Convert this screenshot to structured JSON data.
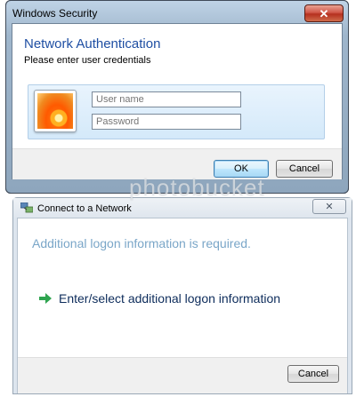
{
  "security_dialog": {
    "title": "Windows Security",
    "heading": "Network Authentication",
    "subheading": "Please enter user credentials",
    "username_placeholder": "User name",
    "password_placeholder": "Password",
    "ok_label": "OK",
    "cancel_label": "Cancel",
    "close_glyph": "✕"
  },
  "watermark": "photobucket",
  "network_dialog": {
    "title": "Connect to a Network",
    "info_text": "Additional logon information is required.",
    "option_text": "Enter/select additional logon information",
    "cancel_label": "Cancel",
    "close_glyph": "✕"
  },
  "icons": {
    "user_tile": "user-picture-flower",
    "network": "network-icon",
    "option_arrow": "green-arrow-icon"
  },
  "colors": {
    "heading": "#1f4fa3",
    "info_text": "#7aa6c8",
    "option_text": "#0d2c5b",
    "arrow": "#2ea44f"
  }
}
